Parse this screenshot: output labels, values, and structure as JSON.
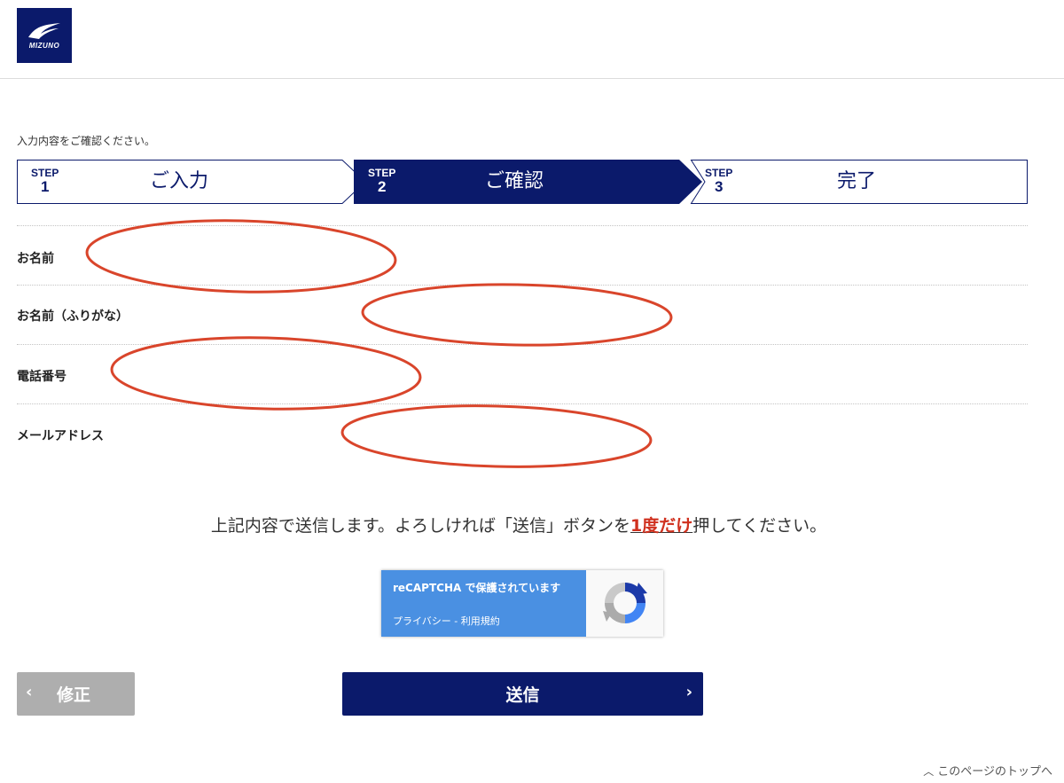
{
  "brand": {
    "logo_text": "MIZUNO",
    "color": "#0b1a6b"
  },
  "intro_text": "入力内容をご確認ください。",
  "steps": [
    {
      "tag": "STEP",
      "num": "1",
      "label": "ご入力",
      "active": false
    },
    {
      "tag": "STEP",
      "num": "2",
      "label": "ご確認",
      "active": true
    },
    {
      "tag": "STEP",
      "num": "3",
      "label": "完了",
      "active": false
    }
  ],
  "fields": [
    {
      "label": "お名前",
      "value": ""
    },
    {
      "label": "お名前（ふりがな）",
      "value": ""
    },
    {
      "label": "電話番号",
      "value": ""
    },
    {
      "label": "メールアドレス",
      "value": ""
    }
  ],
  "notice": {
    "before": "上記内容で送信します。よろしければ「送信」ボタンを",
    "emphasis": "1度だけ",
    "after": "押してください。"
  },
  "recaptcha": {
    "line1": "reCAPTCHA で保護されています",
    "privacy": "プライバシー",
    "separator": " - ",
    "terms": "利用規約"
  },
  "buttons": {
    "back_label": "修正",
    "submit_label": "送信"
  },
  "footer": {
    "to_top": "このページのトップへ"
  },
  "colors": {
    "accent": "#0b1a6b",
    "emphasis": "#d0311f",
    "redaction": "#d9452b",
    "recaptcha_blue": "#4a90e2",
    "back_button": "#aeaeae"
  }
}
